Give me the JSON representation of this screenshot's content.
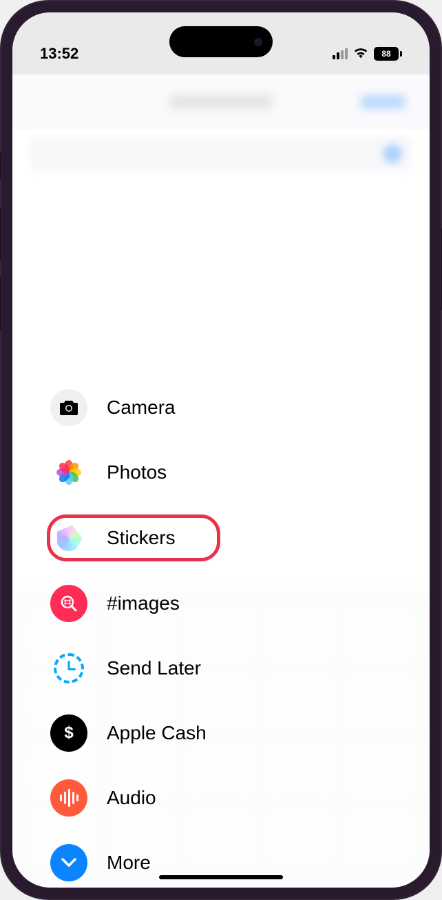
{
  "status": {
    "time": "13:52",
    "battery": "88"
  },
  "menu": {
    "items": [
      {
        "id": "camera",
        "label": "Camera"
      },
      {
        "id": "photos",
        "label": "Photos"
      },
      {
        "id": "stickers",
        "label": "Stickers"
      },
      {
        "id": "images",
        "label": "#images"
      },
      {
        "id": "sendlater",
        "label": "Send Later"
      },
      {
        "id": "applecash",
        "label": "Apple Cash"
      },
      {
        "id": "audio",
        "label": "Audio"
      },
      {
        "id": "more",
        "label": "More"
      }
    ],
    "highlighted": "stickers"
  },
  "highlight_color": "#e8324a"
}
